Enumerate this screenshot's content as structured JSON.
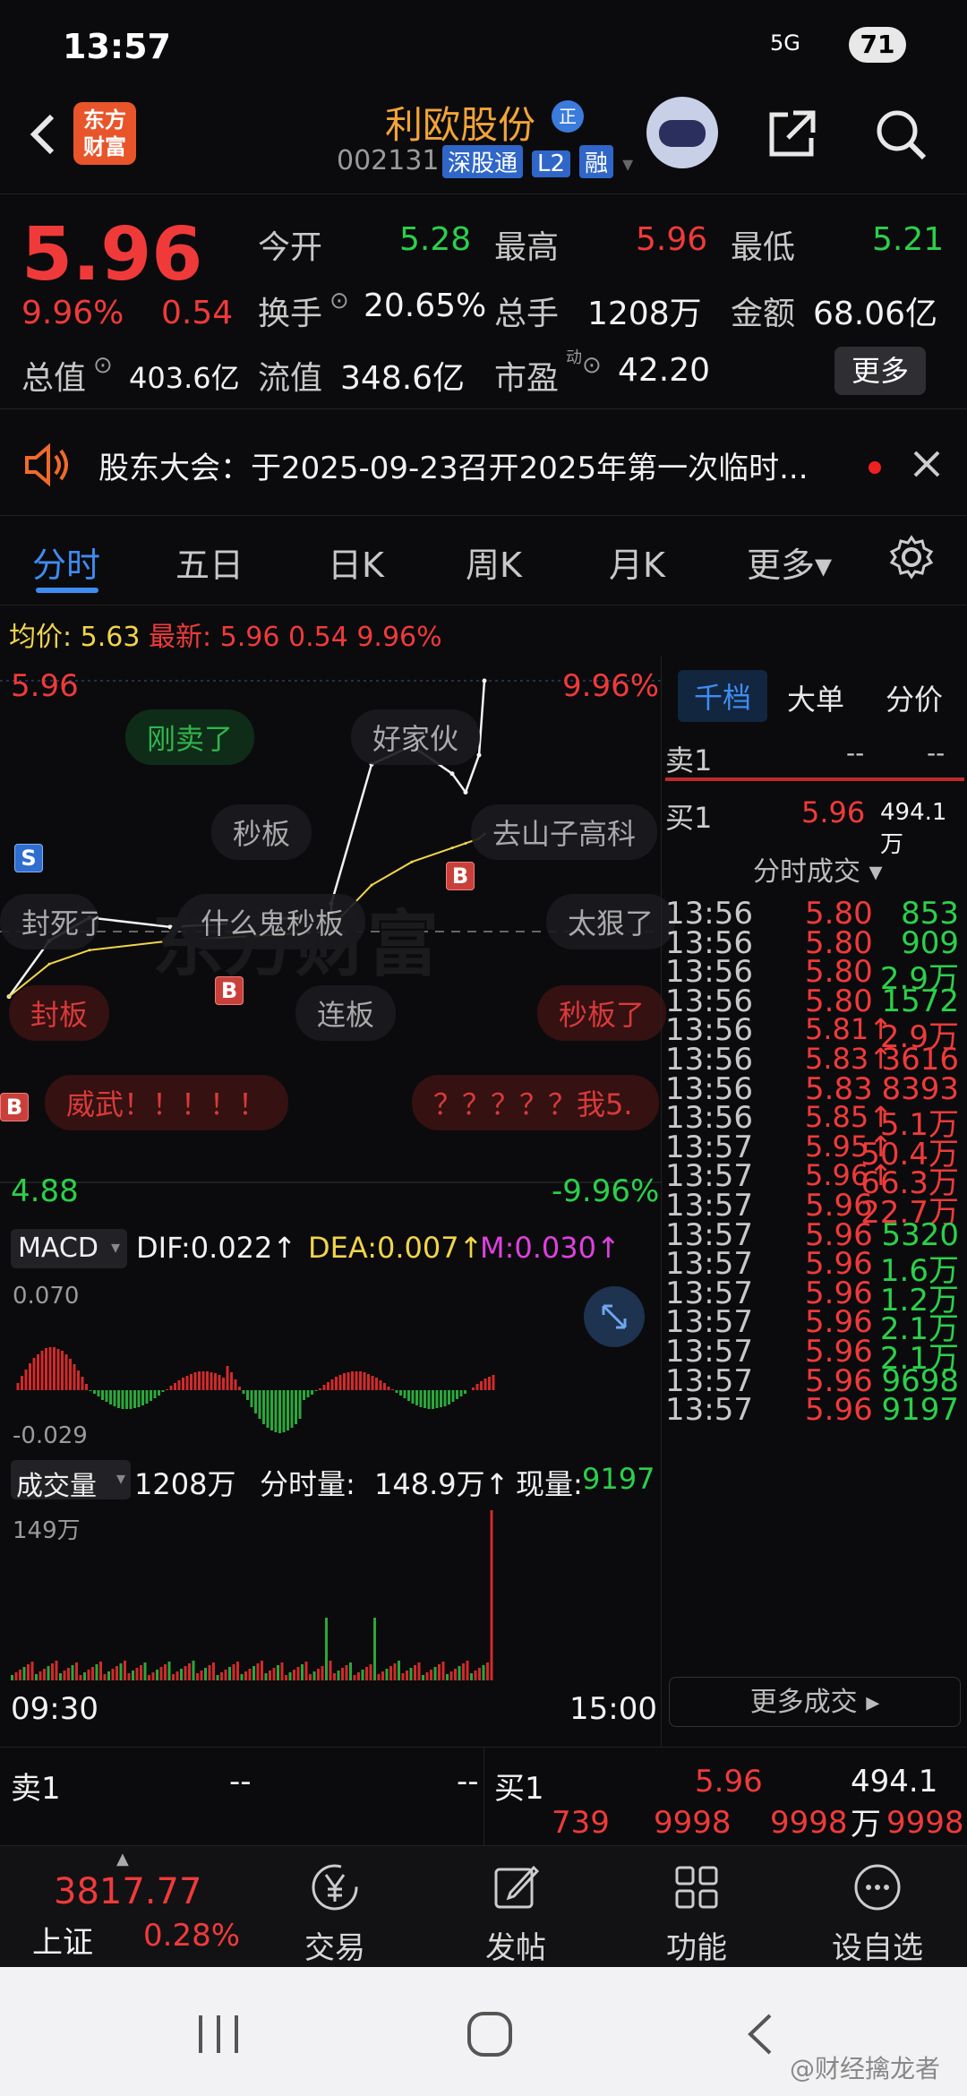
{
  "status": {
    "time": "13:57",
    "signal": "5G",
    "battery": "71"
  },
  "header": {
    "logo_line1": "东方",
    "logo_line2": "财富",
    "name": "利欧股份",
    "name_badge": "正",
    "code": "002131",
    "tags": [
      "深股通",
      "L2",
      "融"
    ]
  },
  "quote": {
    "price": "5.96",
    "pct": "9.96%",
    "change": "0.54",
    "open_label": "今开",
    "open": "5.28",
    "high_label": "最高",
    "high": "5.96",
    "low_label": "最低",
    "low": "5.21",
    "turnover_label": "换手",
    "turnover": "20.65%",
    "volume_label": "总手",
    "volume": "1208万",
    "amount_label": "金额",
    "amount": "68.06亿",
    "mktcap_label": "总值",
    "mktcap": "403.6亿",
    "float_label": "流值",
    "float": "348.6亿",
    "pe_label": "市盈",
    "pe_sup": "动",
    "pe": "42.20",
    "more": "更多"
  },
  "notice": {
    "text": "股东大会：于2025-09-23召开2025年第一次临时..."
  },
  "tabs": [
    "分时",
    "五日",
    "日K",
    "周K",
    "月K",
    "更多▾"
  ],
  "chart": {
    "avg_label": "均价:",
    "avg": "5.63",
    "latest_label": "最新:",
    "latest": "5.96",
    "latest_chg": "0.54",
    "latest_pct": "9.96%",
    "top_price": "5.96",
    "top_pct": "9.96%",
    "bottom_price": "4.88",
    "bottom_pct": "-9.96%",
    "macd": {
      "name": "MACD",
      "dif": "DIF:0.022↑",
      "dea": "DEA:0.007↑",
      "m": "M:0.030↑",
      "max": "0.070",
      "min": "-0.029"
    },
    "vol": {
      "name": "成交量",
      "total": "1208万",
      "fs_label": "分时量:",
      "fs": "148.9万↑",
      "now_label": "现量:",
      "now": "9197",
      "max": "149万"
    },
    "time_start": "09:30",
    "time_end": "15:00",
    "bubbles": [
      "刚卖了",
      "好家伙",
      "秒板",
      "去山子高科",
      "封死了",
      "什么鬼秒板",
      "太狠了",
      "封板",
      "连板",
      "秒板了",
      "威武！！！！！",
      "？？？？？我5."
    ],
    "brand_watermark": "东方财富"
  },
  "chart_data": {
    "type": "line",
    "series": [
      {
        "name": "price",
        "x": [
          "09:30",
          "09:45",
          "10:00",
          "10:30",
          "11:00",
          "11:30",
          "13:00",
          "13:15",
          "13:30",
          "13:45",
          "13:50",
          "13:55",
          "13:57"
        ],
        "values": [
          5.28,
          5.4,
          5.45,
          5.43,
          5.44,
          5.46,
          5.48,
          5.78,
          5.82,
          5.76,
          5.72,
          5.8,
          5.96
        ]
      },
      {
        "name": "avg",
        "x": [
          "09:30",
          "09:45",
          "10:00",
          "10:30",
          "11:00",
          "11:30",
          "13:00",
          "13:15",
          "13:30",
          "13:45",
          "13:50",
          "13:55",
          "13:57"
        ],
        "values": [
          5.28,
          5.35,
          5.38,
          5.4,
          5.41,
          5.42,
          5.43,
          5.52,
          5.57,
          5.6,
          5.61,
          5.62,
          5.63
        ]
      }
    ],
    "ylim": [
      4.88,
      5.96
    ]
  },
  "right": {
    "tabs": [
      "千档",
      "大单",
      "分价"
    ],
    "sell1_label": "卖1",
    "sell1_price": "--",
    "sell1_vol": "--",
    "buy1_label": "买1",
    "buy1_price": "5.96",
    "buy1_vol": "494.1万",
    "trades_title": "分时成交 ▾",
    "trades": [
      {
        "t": "13:56",
        "p": "5.80",
        "v": "853",
        "pc": "red",
        "vc": "green"
      },
      {
        "t": "13:56",
        "p": "5.80",
        "v": "909",
        "pc": "red",
        "vc": "green"
      },
      {
        "t": "13:56",
        "p": "5.80",
        "v": "2.9万",
        "pc": "red",
        "vc": "green"
      },
      {
        "t": "13:56",
        "p": "5.80",
        "v": "1572",
        "pc": "red",
        "vc": "green"
      },
      {
        "t": "13:56",
        "p": "5.81↑",
        "v": "2.9万",
        "pc": "red",
        "vc": "red"
      },
      {
        "t": "13:56",
        "p": "5.83↑",
        "v": "3616",
        "pc": "red",
        "vc": "red"
      },
      {
        "t": "13:56",
        "p": "5.83",
        "v": "8393",
        "pc": "red",
        "vc": "red"
      },
      {
        "t": "13:56",
        "p": "5.85↑",
        "v": "5.1万",
        "pc": "red",
        "vc": "red"
      },
      {
        "t": "13:57",
        "p": "5.95↑",
        "v": "50.4万",
        "pc": "red",
        "vc": "red"
      },
      {
        "t": "13:57",
        "p": "5.96↑",
        "v": "66.3万",
        "pc": "red",
        "vc": "red"
      },
      {
        "t": "13:57",
        "p": "5.96",
        "v": "22.7万",
        "pc": "red",
        "vc": "red"
      },
      {
        "t": "13:57",
        "p": "5.96",
        "v": "5320",
        "pc": "red",
        "vc": "green"
      },
      {
        "t": "13:57",
        "p": "5.96",
        "v": "1.6万",
        "pc": "red",
        "vc": "green"
      },
      {
        "t": "13:57",
        "p": "5.96",
        "v": "1.2万",
        "pc": "red",
        "vc": "green"
      },
      {
        "t": "13:57",
        "p": "5.96",
        "v": "2.1万",
        "pc": "red",
        "vc": "green"
      },
      {
        "t": "13:57",
        "p": "5.96",
        "v": "2.1万",
        "pc": "red",
        "vc": "green"
      },
      {
        "t": "13:57",
        "p": "5.96",
        "v": "9698",
        "pc": "red",
        "vc": "green"
      },
      {
        "t": "13:57",
        "p": "5.96",
        "v": "9197",
        "pc": "red",
        "vc": "green"
      }
    ],
    "more_trades": "更多成交 ▸"
  },
  "book": {
    "sell_label": "卖1",
    "sell_p": "--",
    "sell_v": "--",
    "buy_label": "买1",
    "buy_p": "5.96",
    "buy_v": "494.1万",
    "levels": [
      "739",
      "9998",
      "9998",
      "9998"
    ]
  },
  "nav": {
    "index_value": "3817.77",
    "index_name": "上证",
    "index_pct": "0.28%",
    "items": [
      "交易",
      "发帖",
      "功能",
      "设自选"
    ]
  },
  "watermark": "@财经擒龙者",
  "colors": {
    "up": "#f03a3a",
    "down": "#2bd04a",
    "accent": "#3f8cf2",
    "avg": "#f1d54a"
  }
}
